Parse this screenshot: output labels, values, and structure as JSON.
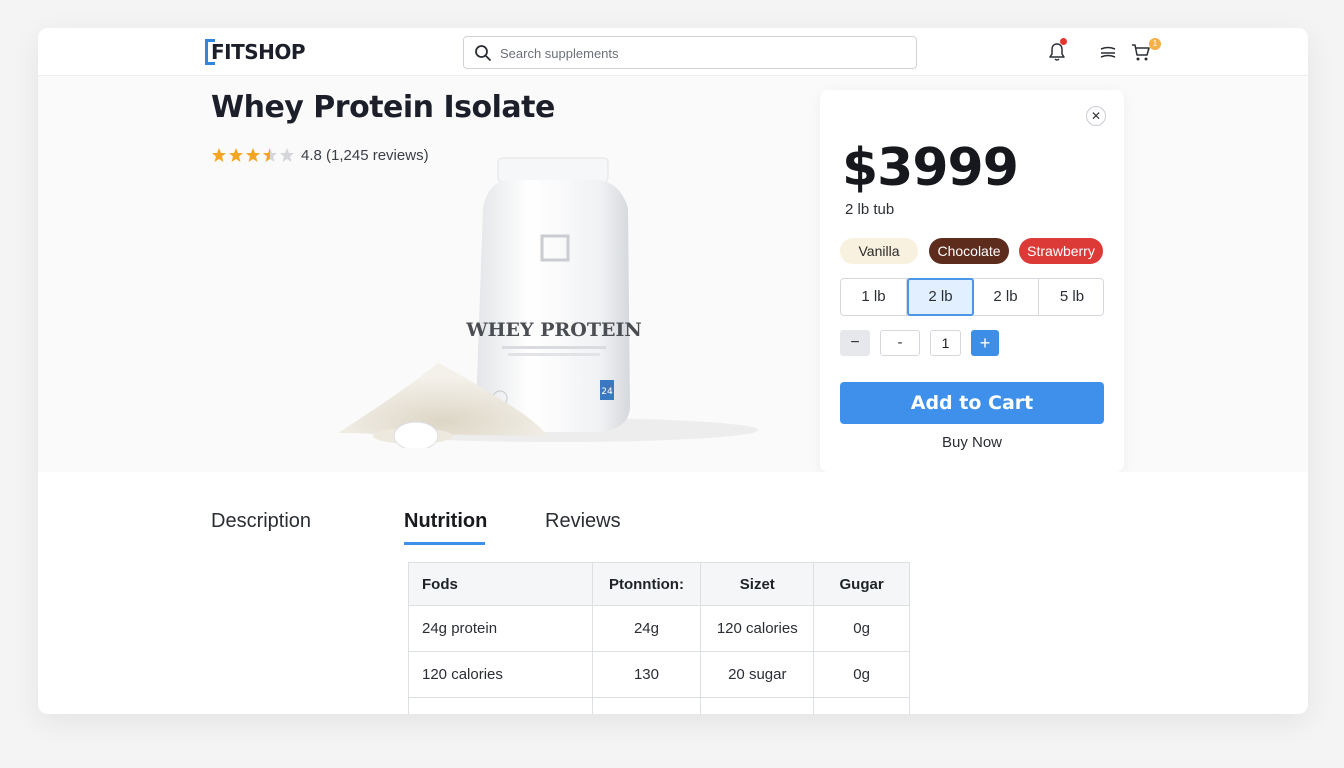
{
  "header": {
    "logo": "FITSHOP",
    "search_placeholder": "Search supplements",
    "cart_count": "1"
  },
  "product": {
    "title": "Whey Protein Isolate",
    "rating_text": "4.8 (1,245 reviews)",
    "rating_stars": 3.5,
    "image_label": "WHEY PROTEIN",
    "image_badge": "24"
  },
  "purchase": {
    "price": "$3999",
    "size_label": "2 lb tub",
    "flavors": [
      "Vanilla",
      "Chocolate",
      "Strawberry"
    ],
    "sizes": [
      "1 lb",
      "2 lb",
      "2 lb",
      "5 lb"
    ],
    "selected_size_index": 1,
    "qty_minus": "-",
    "quantity": "1",
    "add_to_cart": "Add to Cart",
    "buy_now": "Buy Now"
  },
  "tabs": [
    "Description",
    "Nutrition",
    "Reviews"
  ],
  "active_tab": "Nutrition",
  "nutrition_table": {
    "headers": [
      "Fods",
      "Ptonntion:",
      "Sizet",
      "Gugar"
    ],
    "rows": [
      [
        "24g protein",
        "24g",
        "120 calories",
        "0g"
      ],
      [
        "120 calories",
        "130",
        "20 sugar",
        "0g"
      ]
    ]
  },
  "colors": {
    "accent": "#3e90ea",
    "vanilla": "#f8f1df",
    "chocolate": "#5d2c1d",
    "strawberry": "#db3a37",
    "notification": "#e8342f"
  }
}
